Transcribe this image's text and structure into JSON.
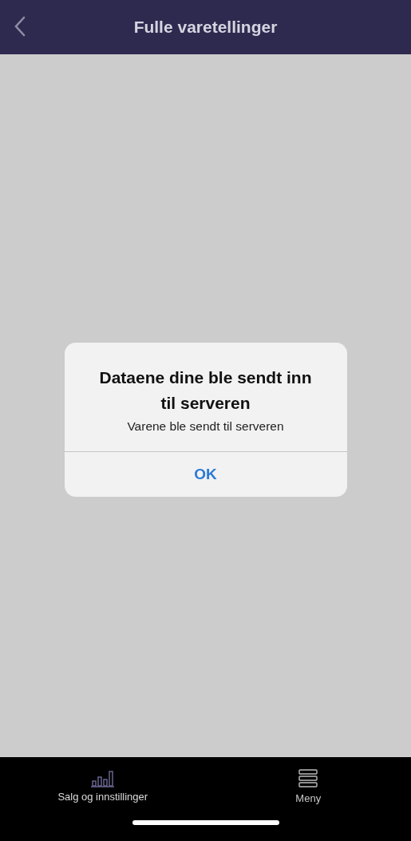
{
  "header": {
    "title": "Fulle varetellinger"
  },
  "alert": {
    "title": "Dataene dine ble sendt inn til serveren",
    "message": "Varene ble sendt til serveren",
    "button": "OK"
  },
  "tab_bar": [
    {
      "label": "Salg og innstillinger",
      "kind": "chart",
      "selected": true
    },
    {
      "label": "Meny",
      "kind": "menu",
      "selected": false
    }
  ]
}
